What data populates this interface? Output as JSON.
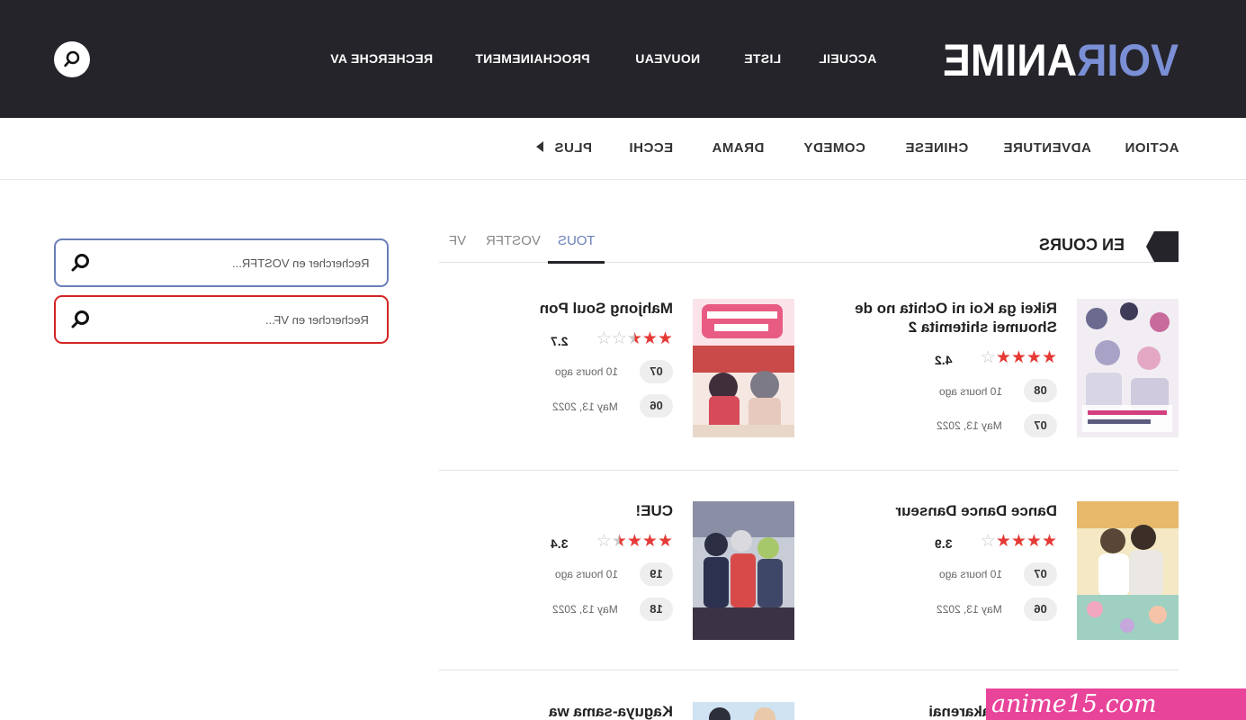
{
  "brand": {
    "logo_text_part1": "VOIR",
    "logo_text_part2": "ANIME"
  },
  "nav": [
    "ACCUEIL",
    "LISTE",
    "NOUVEAU",
    "PROCHAINEMENT",
    "RECHERCHE AV"
  ],
  "genres": [
    "ACTION",
    "ADVENTURE",
    "CHINESE",
    "COMEDY",
    "DRAMA",
    "ECCHI",
    "PLUS"
  ],
  "sidebar": {
    "search_vostfr_placeholder": "Rechercher en VOSTFR...",
    "search_vf_placeholder": "Rechercher en VF..."
  },
  "section": {
    "title": "EN COURS",
    "tabs": [
      "TOUS",
      "VOSTFR",
      "VF"
    ],
    "active_tab": "TOUS"
  },
  "anime": [
    {
      "title": "Rikei ga Koi ni Ochita no de Shoumei shitemita 2",
      "rating": "4.2",
      "stars": 4.2,
      "episodes": [
        {
          "num": "08",
          "date": "10 hours ago"
        },
        {
          "num": "07",
          "date": "May 13, 2022"
        }
      ]
    },
    {
      "title": "Mahjong Soul Pon",
      "rating": "2.7",
      "stars": 2.5,
      "episodes": [
        {
          "num": "07",
          "date": "10 hours ago"
        },
        {
          "num": "06",
          "date": "May 13, 2022"
        }
      ]
    },
    {
      "title": "Dance Dance Danseur",
      "rating": "3.9",
      "stars": 4,
      "episodes": [
        {
          "num": "07",
          "date": "10 hours ago"
        },
        {
          "num": "06",
          "date": "May 13, 2022"
        }
      ]
    },
    {
      "title": "CUE!",
      "rating": "3.4",
      "stars": 3.5,
      "episodes": [
        {
          "num": "19",
          "date": "10 hours ago"
        },
        {
          "num": "18",
          "date": "May 13, 2022"
        }
      ]
    },
    {
      "title": "san wa Hakarenai",
      "rating": "",
      "stars": 0,
      "episodes": []
    },
    {
      "title": "Kaguya-sama wa",
      "rating": "",
      "stars": 0,
      "episodes": []
    }
  ],
  "watermark": "anime15.com",
  "colors": {
    "header_bg": "#24242a",
    "accent_blue": "#6a7fb8",
    "accent_red": "#d42424",
    "star": "#e53935",
    "watermark_bg": "#e8449a"
  }
}
